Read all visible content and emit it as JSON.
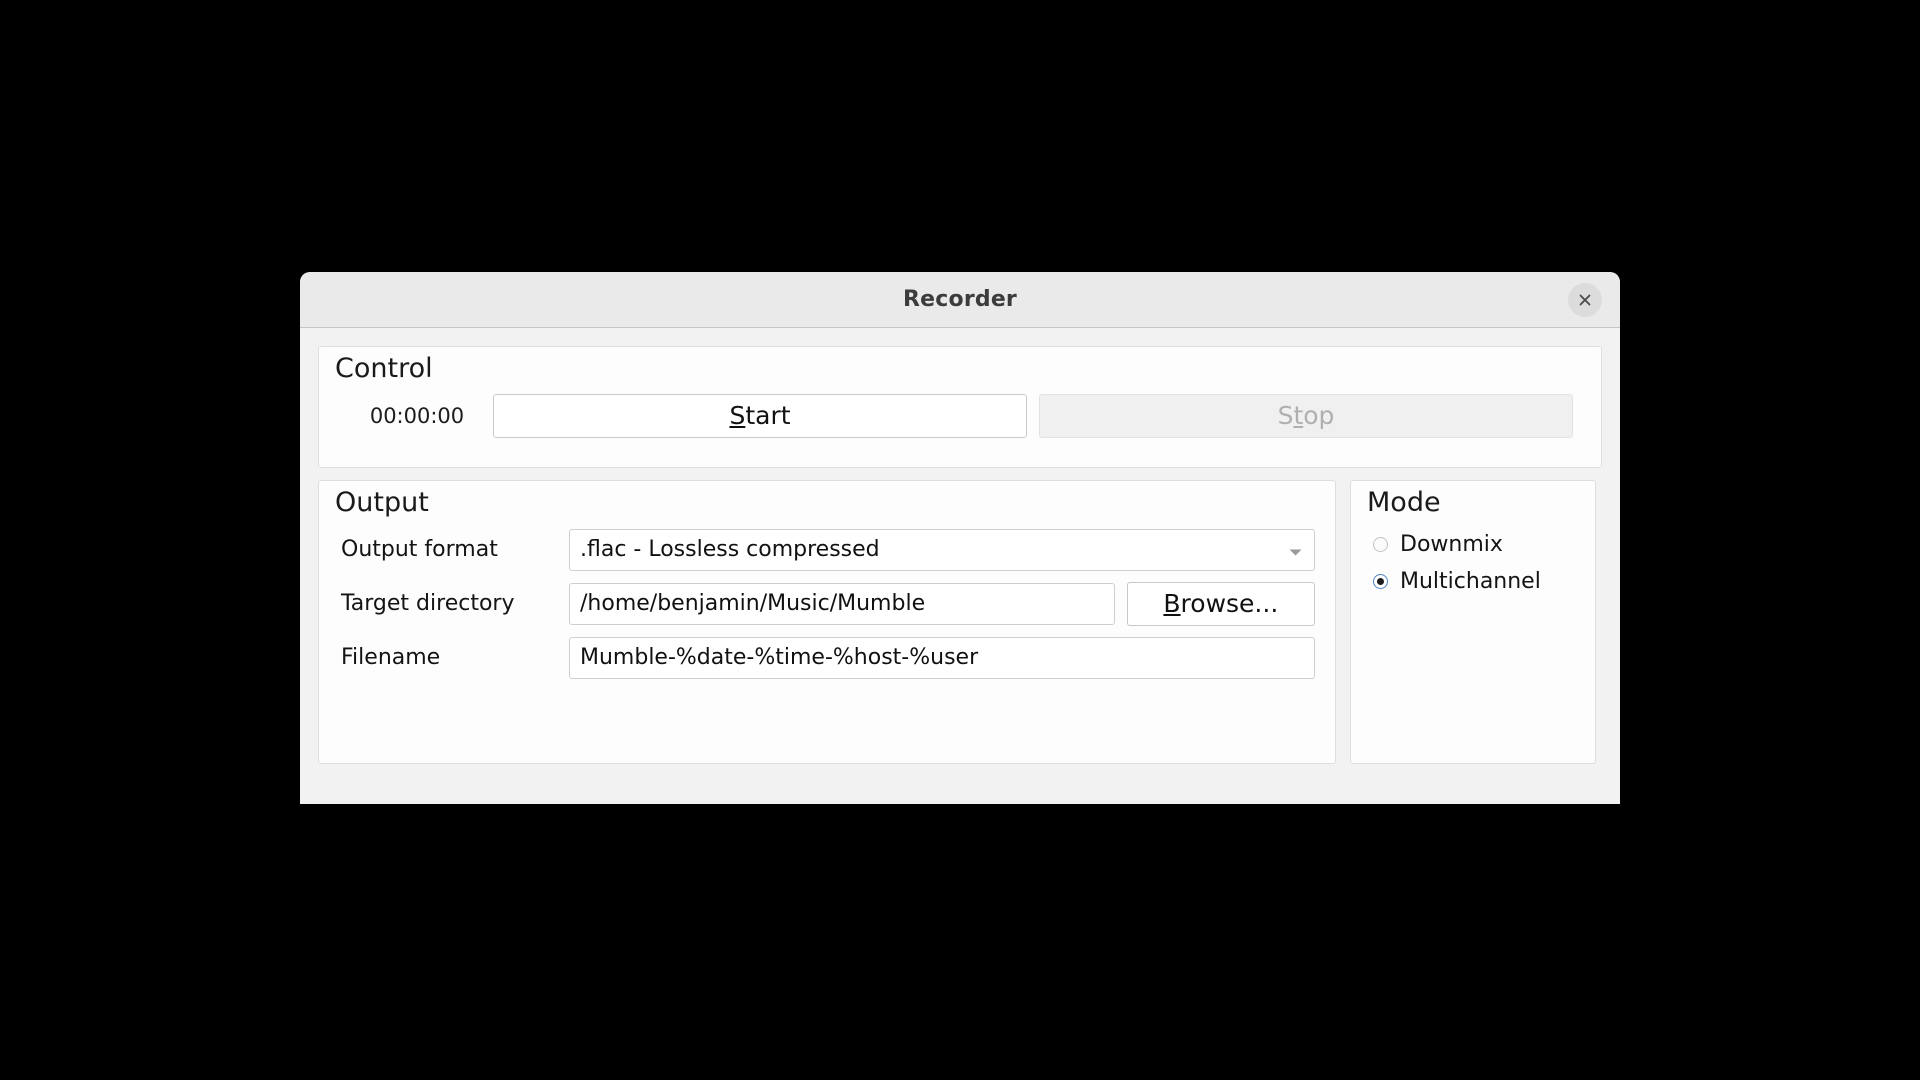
{
  "window": {
    "title": "Recorder",
    "close_icon": "close-icon"
  },
  "control": {
    "group_title": "Control",
    "timer": "00:00:00",
    "start": {
      "label": "Start",
      "mnemonic": "S",
      "rest": "tart",
      "enabled": true
    },
    "stop": {
      "label": "Stop",
      "prefix": "S",
      "mnemonic": "t",
      "rest": "op",
      "enabled": false
    }
  },
  "output": {
    "group_title": "Output",
    "format": {
      "label": "Output format",
      "value": ".flac - Lossless compressed",
      "arrow_icon": "chevron-down-icon"
    },
    "target_directory": {
      "label": "Target directory",
      "value": "/home/benjamin/Music/Mumble"
    },
    "browse": {
      "mnemonic": "B",
      "rest": "rowse...",
      "label": "Browse..."
    },
    "filename": {
      "label": "Filename",
      "value": "Mumble-%date-%time-%host-%user"
    }
  },
  "mode": {
    "group_title": "Mode",
    "options": [
      {
        "label": "Downmix",
        "selected": false
      },
      {
        "label": "Multichannel",
        "selected": true
      }
    ]
  },
  "colors": {
    "titlebar": "#eaeaea",
    "dialog_bg": "#f2f2f2",
    "group_bg": "#fdfdfd",
    "accent": "#4e84c4",
    "disabled_text": "#b0b0b0"
  }
}
